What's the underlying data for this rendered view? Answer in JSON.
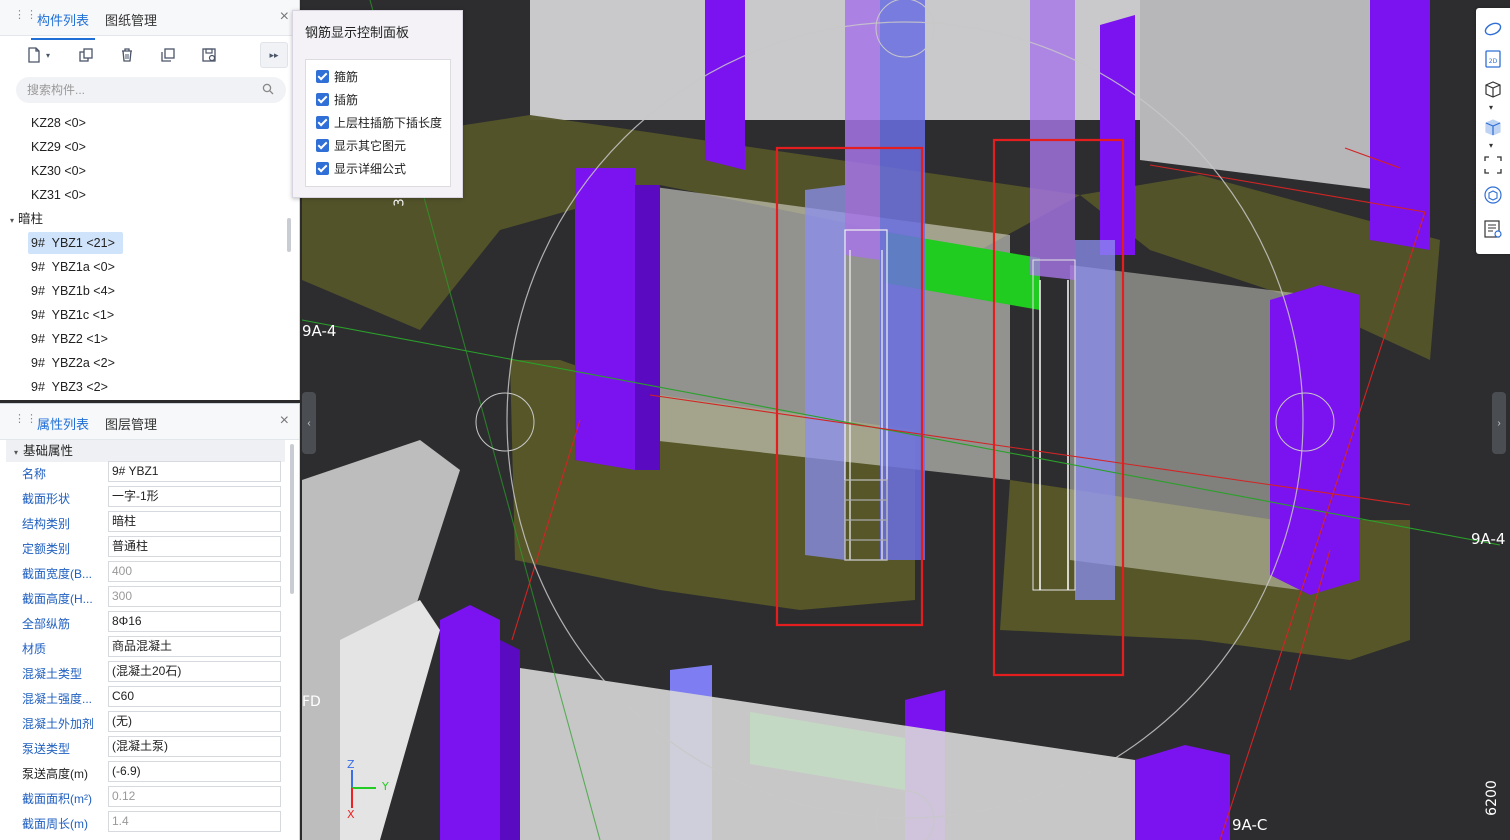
{
  "component_panel": {
    "tabs": [
      "构件列表",
      "图纸管理"
    ],
    "close": "×",
    "search_placeholder": "搜索构件...",
    "items": [
      {
        "label": "KZ28 <0>"
      },
      {
        "label": "KZ29 <0>"
      },
      {
        "label": "KZ30 <0>"
      },
      {
        "label": "KZ31 <0>"
      }
    ],
    "group": "暗柱",
    "group_items": [
      {
        "label": "9#  YBZ1 <21>",
        "selected": true
      },
      {
        "label": "9#  YBZ1a <0>"
      },
      {
        "label": "9#  YBZ1b <4>"
      },
      {
        "label": "9#  YBZ1c <1>"
      },
      {
        "label": "9#  YBZ2 <1>"
      },
      {
        "label": "9#  YBZ2a <2>"
      },
      {
        "label": "9#  YBZ3 <2>"
      }
    ]
  },
  "property_panel": {
    "tabs": [
      "属性列表",
      "图层管理"
    ],
    "close": "×",
    "section": "基础属性",
    "rows": [
      {
        "key": "名称",
        "value": "9#  YBZ1"
      },
      {
        "key": "截面形状",
        "value": "一字-1形"
      },
      {
        "key": "结构类别",
        "value": "暗柱"
      },
      {
        "key": "定额类别",
        "value": "普通柱"
      },
      {
        "key": "截面宽度(B...",
        "value": "400",
        "muted": true
      },
      {
        "key": "截面高度(H...",
        "value": "300",
        "muted": true
      },
      {
        "key": "全部纵筋",
        "value": "8Φ16"
      },
      {
        "key": "材质",
        "value": "商品混凝土"
      },
      {
        "key": "混凝土类型",
        "value": "(混凝土20石)"
      },
      {
        "key": "混凝土强度...",
        "value": "C60"
      },
      {
        "key": "混凝土外加剂",
        "value": "(无)"
      },
      {
        "key": "泵送类型",
        "value": "(混凝土泵)"
      },
      {
        "key": "泵送高度(m)",
        "value": "(-6.9)",
        "black": true
      },
      {
        "key": "截面面积(m²)",
        "value": "0.12",
        "muted": true
      },
      {
        "key": "截面周长(m)",
        "value": "1.4",
        "muted": true
      }
    ]
  },
  "rebar_panel": {
    "title": "钢筋显示控制面板",
    "options": [
      {
        "label": "箍筋",
        "checked": true
      },
      {
        "label": "插筋",
        "checked": true
      },
      {
        "label": "上层柱插筋下插长度",
        "checked": true
      },
      {
        "label": "显示其它图元",
        "checked": true
      },
      {
        "label": "显示详细公式",
        "checked": true
      }
    ]
  },
  "viewport": {
    "axis_labels": {
      "grid_9a4_left": "9A-4",
      "grid_9a4_right": "9A-4",
      "grid_9ac": "9A-C",
      "dim_6200": "6200",
      "dim_3": "3",
      "grid_fd": "FD"
    },
    "gizmo": {
      "z": "Z",
      "y": "Y",
      "x": "X"
    },
    "colors": {
      "column_purple": "#7b12f0",
      "slab_olive": "#5a5a26",
      "beam_green": "#1fcc1f",
      "highlight_red": "#e41e1e"
    }
  }
}
